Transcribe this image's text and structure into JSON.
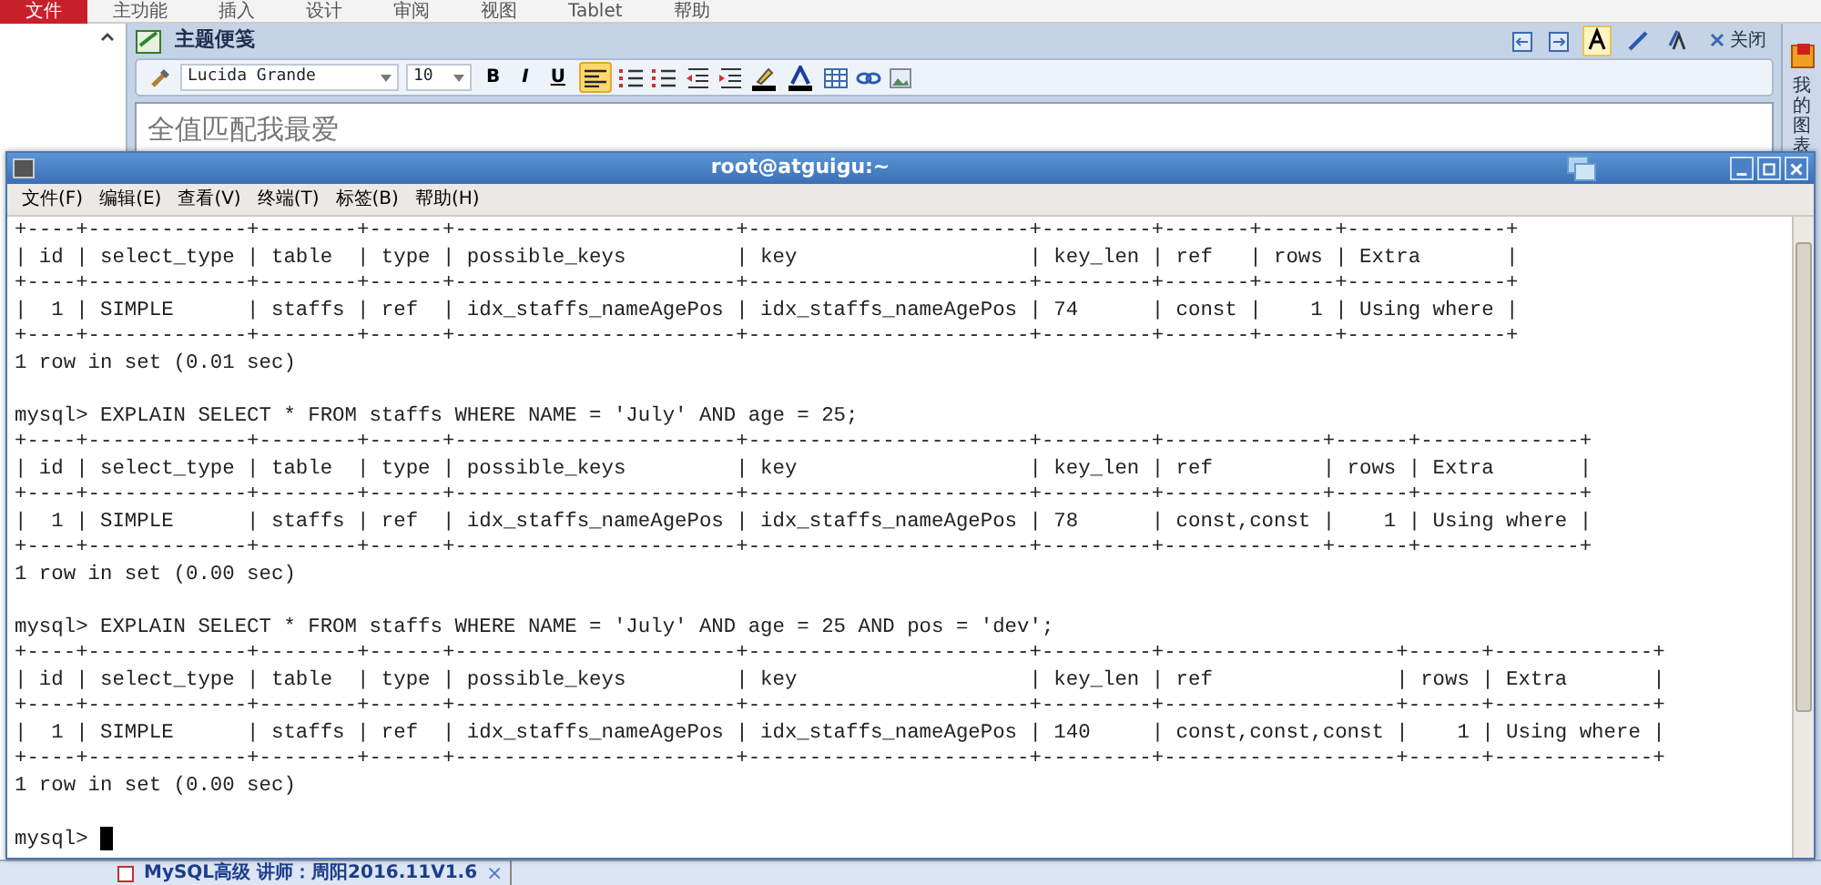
{
  "ribbon": {
    "tabs": [
      {
        "label": "文件",
        "selected": true
      },
      {
        "label": "主功能",
        "selected": false
      },
      {
        "label": "插入",
        "selected": false
      },
      {
        "label": "设计",
        "selected": false
      },
      {
        "label": "审阅",
        "selected": false
      },
      {
        "label": "视图",
        "selected": false
      },
      {
        "label": "Tablet",
        "selected": false
      },
      {
        "label": "帮助",
        "selected": false
      }
    ]
  },
  "note": {
    "title": "主题便笺",
    "font": "Lucida Grande",
    "size": "10",
    "format_buttons": [
      {
        "kind": "bold",
        "label": "B"
      },
      {
        "kind": "italic",
        "label": "I"
      },
      {
        "kind": "underline",
        "label": "U"
      }
    ],
    "align_on": true,
    "modes": [
      {
        "selected": true
      },
      {
        "selected": false
      },
      {
        "selected": false
      }
    ],
    "close_label": "关闭",
    "content": "全值匹配我最爱"
  },
  "side_panel": {
    "label": "我的图表"
  },
  "terminal": {
    "title": "root@atguigu:~",
    "menu": [
      "文件(F)",
      "编辑(E)",
      "查看(V)",
      "终端(T)",
      "标签(B)",
      "帮助(H)"
    ],
    "lines": [
      {
        "kind": "text",
        "text": "+----+-------------+--------+------+-----------------------+-----------------------+---------+-------+------+-------------+"
      },
      {
        "kind": "text",
        "text": "| id | select_type | table  | type | possible_keys         | key                   | key_len | ref   | rows | Extra       |"
      },
      {
        "kind": "text",
        "text": "+----+-------------+--------+------+-----------------------+-----------------------+---------+-------+------+-------------+"
      },
      {
        "kind": "text",
        "text": "|  1 | SIMPLE      | staffs | ref  | idx_staffs_nameAgePos | idx_staffs_nameAgePos | 74      | const |    1 | Using where |"
      },
      {
        "kind": "text",
        "text": "+----+-------------+--------+------+-----------------------+-----------------------+---------+-------+------+-------------+"
      },
      {
        "kind": "text",
        "text": "1 row in set (0.01 sec)"
      },
      {
        "kind": "blank"
      },
      {
        "kind": "text",
        "text": "mysql> EXPLAIN SELECT * FROM staffs WHERE NAME = 'July' AND age = 25;"
      },
      {
        "kind": "text",
        "text": "+----+-------------+--------+------+-----------------------+-----------------------+---------+-------------+------+-------------+"
      },
      {
        "kind": "text",
        "text": "| id | select_type | table  | type | possible_keys         | key                   | key_len | ref         | rows | Extra       |"
      },
      {
        "kind": "text",
        "text": "+----+-------------+--------+------+-----------------------+-----------------------+---------+-------------+------+-------------+"
      },
      {
        "kind": "text",
        "text": "|  1 | SIMPLE      | staffs | ref  | idx_staffs_nameAgePos | idx_staffs_nameAgePos | 78      | const,const |    1 | Using where |"
      },
      {
        "kind": "text",
        "text": "+----+-------------+--------+------+-----------------------+-----------------------+---------+-------------+------+-------------+"
      },
      {
        "kind": "text",
        "text": "1 row in set (0.00 sec)"
      },
      {
        "kind": "blank"
      },
      {
        "kind": "text",
        "text": "mysql> EXPLAIN SELECT * FROM staffs WHERE NAME = 'July' AND age = 25 AND pos = 'dev';"
      },
      {
        "kind": "text",
        "text": "+----+-------------+--------+------+-----------------------+-----------------------+---------+-------------------+------+-------------+"
      },
      {
        "kind": "text",
        "text": "| id | select_type | table  | type | possible_keys         | key                   | key_len | ref               | rows | Extra       |"
      },
      {
        "kind": "text",
        "text": "+----+-------------+--------+------+-----------------------+-----------------------+---------+-------------------+------+-------------+"
      },
      {
        "kind": "text",
        "text": "|  1 | SIMPLE      | staffs | ref  | idx_staffs_nameAgePos | idx_staffs_nameAgePos | 140     | const,const,const |    1 | Using where |"
      },
      {
        "kind": "text",
        "text": "+----+-------------+--------+------+-----------------------+-----------------------+---------+-------------------+------+-------------+"
      },
      {
        "kind": "text",
        "text": "1 row in set (0.00 sec)"
      },
      {
        "kind": "blank"
      },
      {
        "kind": "prompt",
        "text": "mysql>"
      }
    ]
  },
  "taskbar": {
    "tab_label": "MySQL高级 讲师：周阳2016.11V1.6",
    "close": "×"
  }
}
